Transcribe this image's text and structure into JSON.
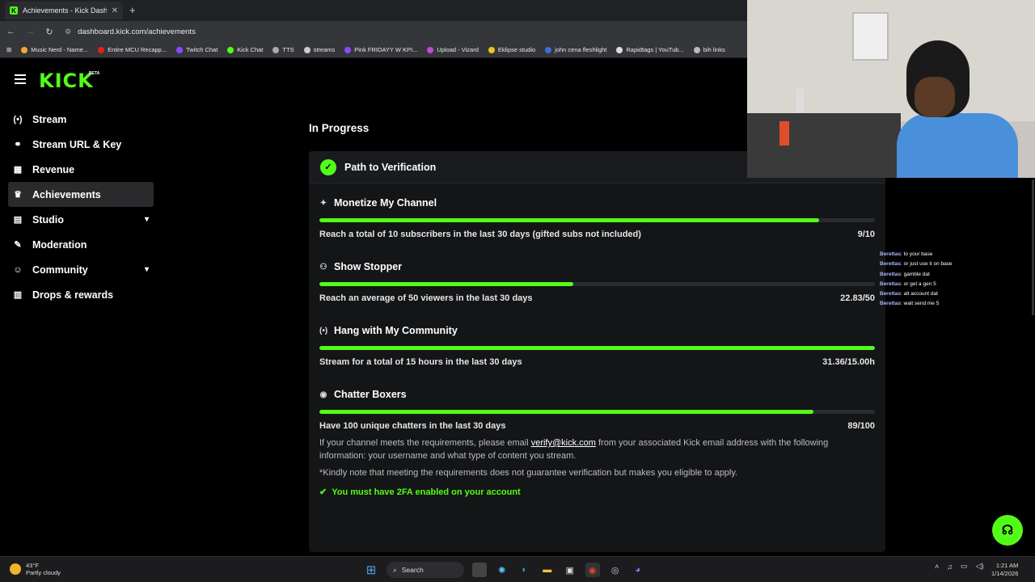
{
  "browser": {
    "tab_title": "Achievements - Kick Dashboard",
    "tab_favicon": "K",
    "url": "dashboard.kick.com/achievements",
    "bookmarks": [
      "Music Nerd - Name...",
      "Entire MCU Recapp...",
      "Twitch Chat",
      "Kick Chat",
      "TTS",
      "streams",
      "Pink FRIDAYY W KPI...",
      "Upload - Vizard",
      "Eklipse studio",
      "john cena fleshlight",
      "Rapidtags | YouTub...",
      "bih links"
    ]
  },
  "app": {
    "logo": "KICK",
    "beta": "BETA",
    "accent": "#53fc18"
  },
  "sidebar": {
    "items": [
      {
        "label": "Stream",
        "icon": "broadcast-icon"
      },
      {
        "label": "Stream URL & Key",
        "icon": "link-icon"
      },
      {
        "label": "Revenue",
        "icon": "chart-icon"
      },
      {
        "label": "Achievements",
        "icon": "trophy-icon"
      },
      {
        "label": "Studio",
        "icon": "film-icon"
      },
      {
        "label": "Moderation",
        "icon": "wrench-icon"
      },
      {
        "label": "Community",
        "icon": "people-icon"
      },
      {
        "label": "Drops & rewards",
        "icon": "gift-icon"
      }
    ]
  },
  "main": {
    "section_title": "In Progress",
    "card_title": "Path to Verification",
    "achievements": [
      {
        "title": "Monetize My Channel",
        "desc": "Reach a total of 10 subscribers in the last 30 days (gifted subs not included)",
        "progress": "9/10",
        "fraction": 0.9
      },
      {
        "title": "Show Stopper",
        "desc": "Reach an average of 50 viewers in the last 30 days",
        "progress": "22.83/50",
        "fraction": 0.457
      },
      {
        "title": "Hang with My Community",
        "desc": "Stream for a total of 15 hours in the last 30 days",
        "progress": "31.36/15.00h",
        "fraction": 1.0
      },
      {
        "title": "Chatter Boxers",
        "desc": "Have 100 unique chatters in the last 30 days",
        "progress": "89/100",
        "fraction": 0.89
      }
    ],
    "info_prefix": "If your channel meets the requirements, please email ",
    "info_email": "verify@kick.com",
    "info_suffix": " from your associated Kick email address with the following information: your username and what type of content you stream.",
    "note": "*Kindly note that meeting the requirements does not guarantee verification but makes you eligible to apply.",
    "requirement": "You must have 2FA enabled on your account"
  },
  "chat": [
    {
      "user": "Berettas",
      "msg": ": to your base"
    },
    {
      "user": "Berettas",
      "msg": ": or just use it on base"
    },
    {
      "user": "Berettas",
      "msg": ": gamble dat"
    },
    {
      "user": "Berettas",
      "msg": ": or get a gen 5"
    },
    {
      "user": "Berettas",
      "msg": ": alt account dat"
    },
    {
      "user": "Berettas",
      "msg": ": wait send me 5"
    }
  ],
  "taskbar": {
    "temp": "43°F",
    "weather": "Partly cloudy",
    "search": "Search",
    "time": "1:21 AM",
    "date": "1/14/2026"
  }
}
